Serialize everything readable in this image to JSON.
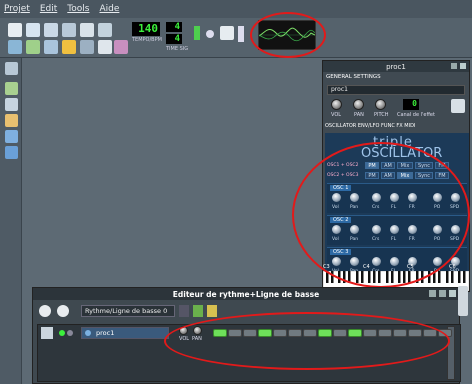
{
  "menu": [
    "Projet",
    "Edit",
    "Tools",
    "Aide"
  ],
  "toolbar": {
    "tempo_value": "140",
    "tempo_label": "TEMPO/BPM",
    "timesig_top": "4",
    "timesig_bottom": "4",
    "timesig_label": "TIME SIG"
  },
  "instrument": {
    "title": "proc1",
    "general_settings": "GENERAL SETTINGS",
    "name_value": "proc1",
    "knobs": [
      "VOL",
      "PAN",
      "PITCH"
    ],
    "fx_label": "Canal de l'effet",
    "fx_value": "0",
    "tabs": "OSCILLATOR   ENV/LFO   FUNC   FX   MIDI",
    "brand_top": "triple",
    "brand_bottom": "OSCILLATOR",
    "mod_rows": [
      "OSC1 + OSC2",
      "OSC2 + OSC3"
    ],
    "mod_buttons": [
      "PM",
      "AM",
      "Mix",
      "Sync",
      "FM"
    ],
    "oscillators": [
      {
        "label": "OSC 1",
        "knobs": [
          "Vol",
          "Pan",
          "Crs",
          "FL",
          "FR",
          "PO",
          "SPD"
        ]
      },
      {
        "label": "OSC 2",
        "knobs": [
          "Vol",
          "Pan",
          "Crs",
          "FL",
          "FR",
          "PO",
          "SPD"
        ]
      },
      {
        "label": "OSC 3",
        "knobs": [
          "Vol",
          "Pan",
          "Crs",
          "FL",
          "FR",
          "PO",
          "SPD"
        ]
      }
    ],
    "keyboard_labels": [
      "C3",
      "C4",
      "C5",
      "C6"
    ]
  },
  "beat_editor": {
    "title": "Editeur de rythme+Ligne de basse",
    "pattern_name": "Rythme/Ligne de basse 0",
    "track_name": "proc1",
    "track_knobs": [
      "VOL",
      "PAN"
    ],
    "steps": [
      true,
      false,
      false,
      true,
      false,
      false,
      false,
      true,
      false,
      true,
      false,
      false,
      false,
      false,
      false,
      false
    ]
  },
  "colors": {
    "accent_green": "#3cf03c",
    "annotation_red": "#e21a1a",
    "synth_blue": "#1c3a58"
  }
}
